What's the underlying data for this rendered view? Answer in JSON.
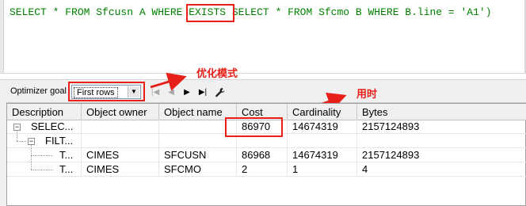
{
  "editor": {
    "sql_part1": "SELECT * FROM Sfcusn A WHERE ",
    "sql_exists": "EXISTS",
    "sql_part2": " SELECT * FROM Sfcmo B WHERE B.line = 'A1')"
  },
  "toolbar": {
    "optimizer_goal_label": "Optimizer goal",
    "optimizer_goal_value": "First rows",
    "optimizer_goal_options": [
      "First rows"
    ]
  },
  "annotations": {
    "optimizer_mode": "优化模式",
    "elapsed_time": "用时"
  },
  "colors": {
    "annotation_red": "#e8201a",
    "keyword_green": "#008000",
    "identifier_navy": "#000080"
  },
  "plan": {
    "columns": [
      "Description",
      "Object owner",
      "Object name",
      "Cost",
      "Cardinality",
      "Bytes"
    ],
    "rows": [
      {
        "description": "SELEC...",
        "owner": "",
        "name": "",
        "cost": "86970",
        "cardinality": "14674319",
        "bytes": "2157124893"
      },
      {
        "description": "FILT...",
        "owner": "",
        "name": "",
        "cost": "",
        "cardinality": "",
        "bytes": ""
      },
      {
        "description": "T...",
        "owner": "CIMES",
        "name": "SFCUSN",
        "cost": "86968",
        "cardinality": "14674319",
        "bytes": "2157124893"
      },
      {
        "description": "T...",
        "owner": "CIMES",
        "name": "SFCMO",
        "cost": "2",
        "cardinality": "1",
        "bytes": "4"
      }
    ]
  }
}
